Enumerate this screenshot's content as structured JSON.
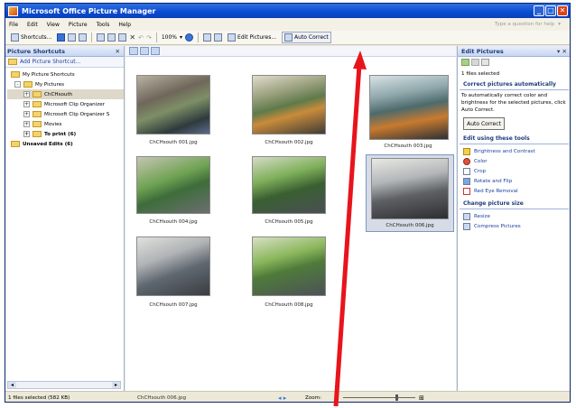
{
  "window": {
    "title": "Microsoft Office Picture Manager",
    "controls": [
      "_",
      "□",
      "✕"
    ]
  },
  "menu": {
    "items": [
      "File",
      "Edit",
      "View",
      "Picture",
      "Tools",
      "Help"
    ],
    "question_placeholder": "Type a question for help"
  },
  "toolbar": {
    "shortcuts_label": "Shortcuts...",
    "zoom_value": "100%",
    "edit_pictures_label": "Edit Pictures...",
    "auto_correct_label": "Auto Correct"
  },
  "left_pane": {
    "title": "Picture Shortcuts",
    "add_shortcut": "Add Picture Shortcut...",
    "tree": [
      {
        "label": "My Picture Shortcuts",
        "level": 0,
        "toggle": "",
        "bold": false,
        "selected": false
      },
      {
        "label": "My Pictures",
        "level": 1,
        "toggle": "-",
        "bold": false,
        "selected": false
      },
      {
        "label": "ChCHsouth",
        "level": 2,
        "toggle": "+",
        "bold": false,
        "selected": true
      },
      {
        "label": "Microsoft Clip Organizer",
        "level": 2,
        "toggle": "+",
        "bold": false,
        "selected": false
      },
      {
        "label": "Microsoft Clip Organizer S",
        "level": 2,
        "toggle": "+",
        "bold": false,
        "selected": false
      },
      {
        "label": "Movies",
        "level": 2,
        "toggle": "+",
        "bold": false,
        "selected": false
      },
      {
        "label": "To print (6)",
        "level": 2,
        "toggle": "+",
        "bold": true,
        "selected": false
      },
      {
        "label": "Unsaved Edits (6)",
        "level": 0,
        "toggle": "",
        "bold": true,
        "selected": false
      }
    ]
  },
  "thumbnails": [
    {
      "caption": "ChCHsouth 001.jpg"
    },
    {
      "caption": "ChCHsouth 002.jpg"
    },
    {
      "caption": "ChCHsouth 003.jpg"
    },
    {
      "caption": "ChCHsouth 004.jpg"
    },
    {
      "caption": "ChCHsouth 005.jpg"
    },
    {
      "caption": "ChCHsouth 006.jpg"
    },
    {
      "caption": "ChCHsouth 007.jpg"
    },
    {
      "caption": "ChCHsouth 008.jpg"
    }
  ],
  "right_pane": {
    "title": "Edit Pictures",
    "files_selected": "1 files selected",
    "section_auto": "Correct pictures automatically",
    "auto_desc": "To automatically correct color and brightness for the selected pictures, click Auto Correct.",
    "auto_button": "Auto Correct",
    "section_tools": "Edit using these tools",
    "tools": [
      "Brightness and Contrast",
      "Color",
      "Crop",
      "Rotate and Flip",
      "Red Eye Removal"
    ],
    "section_size": "Change picture size",
    "size_tools": [
      "Resize",
      "Compress Pictures"
    ]
  },
  "status": {
    "selected": "1 files selected (582 KB)",
    "current_file": "ChCHsouth 006.jpg",
    "zoom_label": "Zoom:"
  },
  "colors": {
    "arrow": "#e8141c",
    "title_bar": "#0b4bd0",
    "pane_header": "#1f3d7a"
  }
}
